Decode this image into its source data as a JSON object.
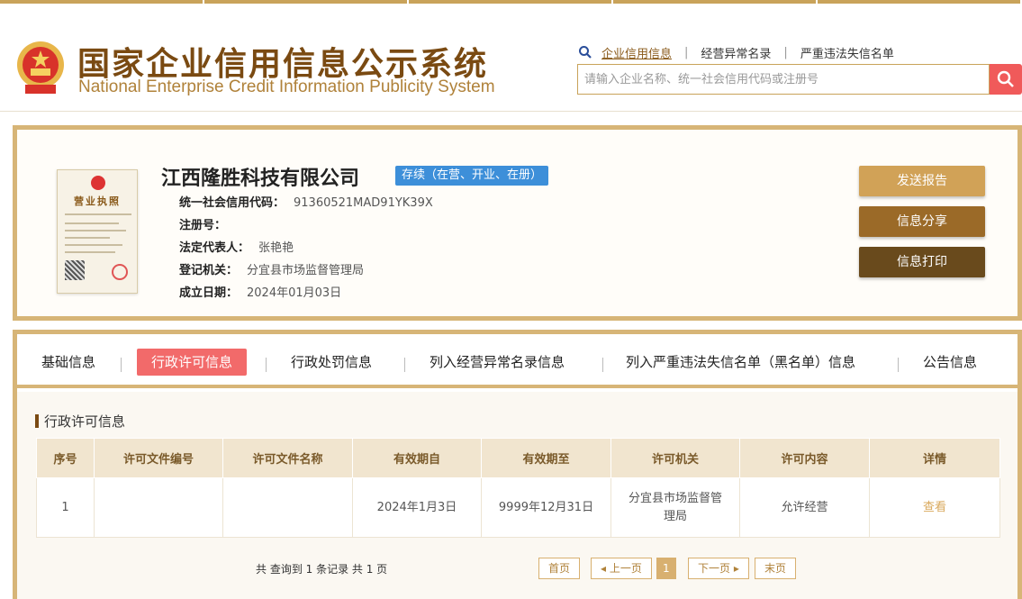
{
  "header": {
    "title_cn": "国家企业信用信息公示系统",
    "title_en": "National Enterprise Credit Information Publicity System",
    "nav": [
      "企业信用信息",
      "经营异常名录",
      "严重违法失信名单"
    ],
    "search_placeholder": "请输入企业名称、统一社会信用代码或注册号"
  },
  "company": {
    "name": "江西隆胜科技有限公司",
    "status": "存续（在营、开业、在册）",
    "license_title": "营业执照",
    "fields": [
      {
        "key": "统一社会信用代码：",
        "value": "91360521MAD91YK39X"
      },
      {
        "key": "注册号：",
        "value": ""
      },
      {
        "key": "法定代表人：",
        "value": "张艳艳"
      },
      {
        "key": "登记机关：",
        "value": "分宜县市场监督管理局"
      },
      {
        "key": "成立日期：",
        "value": "2024年01月03日"
      }
    ],
    "buttons": {
      "send": "发送报告",
      "share": "信息分享",
      "print": "信息打印"
    }
  },
  "tabs": [
    "基础信息",
    "行政许可信息",
    "行政处罚信息",
    "列入经营异常名录信息",
    "列入严重违法失信名单（黑名单）信息",
    "公告信息"
  ],
  "active_tab": "行政许可信息",
  "section": {
    "title": "行政许可信息",
    "columns": [
      "序号",
      "许可文件编号",
      "许可文件名称",
      "有效期自",
      "有效期至",
      "许可机关",
      "许可内容",
      "详情"
    ],
    "rows": [
      {
        "no": "1",
        "doc_no": "",
        "doc_name": "",
        "from": "2024年1月3日",
        "to": "9999年12月31日",
        "authority": "分宜县市场监督管理局",
        "content": "允许经营",
        "detail": "查看"
      }
    ]
  },
  "pager": {
    "summary": "共 查询到 1 条记录 共 1 页",
    "first": "首页",
    "prev": "上一页",
    "current": "1",
    "next": "下一页",
    "last": "末页"
  },
  "colors": {
    "gold": "#d7b577",
    "brown": "#7a4a12",
    "active_tab": "#f26a6a",
    "status_badge": "#3d8fd9"
  },
  "icons": {
    "search": "magnifier-icon",
    "emblem": "national-emblem-icon"
  }
}
